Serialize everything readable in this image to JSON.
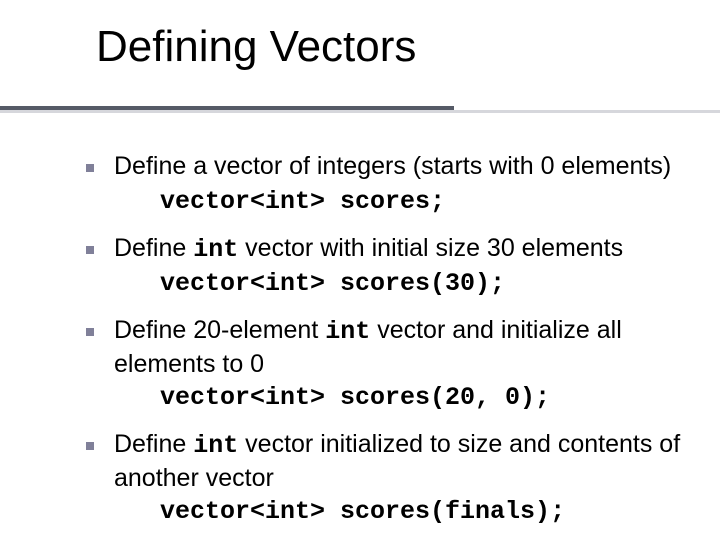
{
  "title": "Defining Vectors",
  "bullets": [
    {
      "text_before": "Define a vector of integers (starts with 0 elements)",
      "inline_code": "",
      "text_after": "",
      "code": "vector<int> scores;"
    },
    {
      "text_before": "Define ",
      "inline_code": "int",
      "text_after": " vector with initial size 30 elements",
      "code": "vector<int> scores(30);"
    },
    {
      "text_before": "Define 20-element ",
      "inline_code": "int",
      "text_after": " vector and initialize all elements to 0",
      "code": "vector<int> scores(20, 0);"
    },
    {
      "text_before": "Define ",
      "inline_code": "int",
      "text_after": " vector initialized to size and contents of another vector",
      "code": "vector<int> scores(finals);"
    }
  ]
}
